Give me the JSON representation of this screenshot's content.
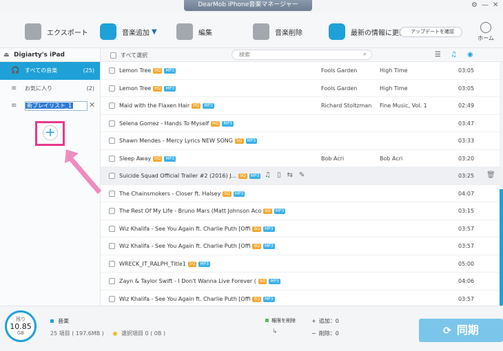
{
  "window": {
    "title": "DearMob iPhone音楽マネージャー"
  },
  "toolbar": {
    "export": "エクスポート",
    "add_music": "音楽追加",
    "edit": "編集",
    "delete_music": "音楽削除",
    "refresh": "最新の情報に更新",
    "update": "アップデートを確認",
    "home": "ホーム"
  },
  "sidebar": {
    "device": "Digiarty's iPad",
    "items": [
      {
        "label": "すべての音楽",
        "count": "(25)"
      },
      {
        "label": "お気に入り",
        "count": "(2)"
      }
    ],
    "new_playlist": "新プレイリスト_1"
  },
  "list": {
    "select_all": "すべて選択",
    "search_placeholder": "検索",
    "rows": [
      {
        "title": "Lemon Tree",
        "q": "HQ",
        "fmt": "MP3",
        "artist": "Fools Garden",
        "album": "High Time",
        "duration": "03:05"
      },
      {
        "title": "Lemon Tree",
        "q": "HQ",
        "fmt": "MP3",
        "artist": "Fools Garden",
        "album": "High Time",
        "duration": "03:05"
      },
      {
        "title": "Maid with the Flaxen Hair",
        "q": "HQ",
        "fmt": "MP3",
        "artist": "Richard Stoltzman",
        "album": "Fine Music, Vol. 1",
        "duration": "02:49"
      },
      {
        "title": "Selena Gomez - Hands To Myself",
        "q": "HQ",
        "fmt": "MP3",
        "artist": "",
        "album": "",
        "duration": "03:47"
      },
      {
        "title": "Shawn Mendes - Mercy Lyrics NEW SONG",
        "q": "SQ",
        "fmt": "MP3",
        "artist": "",
        "album": "",
        "duration": "03:33"
      },
      {
        "title": "Sleep Away",
        "q": "HQ",
        "fmt": "MP3",
        "artist": "Bob Acri",
        "album": "Bob Acri",
        "duration": "03:20"
      },
      {
        "title": "Suicide Squad Official Trailer #2 (2016) J...",
        "q": "SQ",
        "fmt": "MP3",
        "artist": "",
        "album": "",
        "duration": "03:25"
      },
      {
        "title": "The Chainsmokers - Closer ft. Halsey",
        "q": "SQ",
        "fmt": "MP3",
        "artist": "",
        "album": "",
        "duration": "04:07"
      },
      {
        "title": "The Rest Of My Life - Bruno Mars (Matt Johnson Aco",
        "q": "SQ",
        "fmt": "MP3",
        "artist": "",
        "album": "",
        "duration": "03:15"
      },
      {
        "title": "Wiz Khalifa - See You Again ft. Charlie Puth [Offi",
        "q": "SQ",
        "fmt": "MP3",
        "artist": "",
        "album": "",
        "duration": "03:57"
      },
      {
        "title": "Wiz Khalifa - See You Again ft. Charlie Puth [Offi",
        "q": "SQ",
        "fmt": "MP3",
        "artist": "",
        "album": "",
        "duration": "03:57"
      },
      {
        "title": "WRECK_IT_RALPH_Title1",
        "q": "SQ",
        "fmt": "MP3",
        "artist": "",
        "album": "",
        "duration": "05:00"
      },
      {
        "title": "Zayn & Taylor Swift - I Don't Wanna Live Forever (",
        "q": "SQ",
        "fmt": "MP3",
        "artist": "",
        "album": "",
        "duration": "04:06"
      },
      {
        "title": "Wiz Khalifa - See You Again ft. Charlie Puth [Offi",
        "q": "SQ",
        "fmt": "MP3",
        "artist": "",
        "album": "",
        "duration": "03:57"
      }
    ]
  },
  "footer": {
    "storage_label": "残り",
    "storage_value": "10.85",
    "storage_unit": "GB",
    "category": "音楽",
    "items": "25 項目 ( 197.6MB )",
    "selected": "選択項目 0 ( 0B )",
    "delete_perm": "権限を削除",
    "add": "追加：0",
    "remove": "削除：0",
    "sync": "同期"
  },
  "colors": {
    "accent": "#1fa1d8",
    "highlight_box": "#e8388d",
    "sync": "#7cc5ea"
  },
  "icons": [
    "export-icon",
    "add-music-icon",
    "edit-icon",
    "delete-music-icon",
    "refresh-icon",
    "home-icon",
    "settings-icon",
    "search-icon",
    "list-view-icon",
    "trash-icon",
    "plus-icon"
  ]
}
